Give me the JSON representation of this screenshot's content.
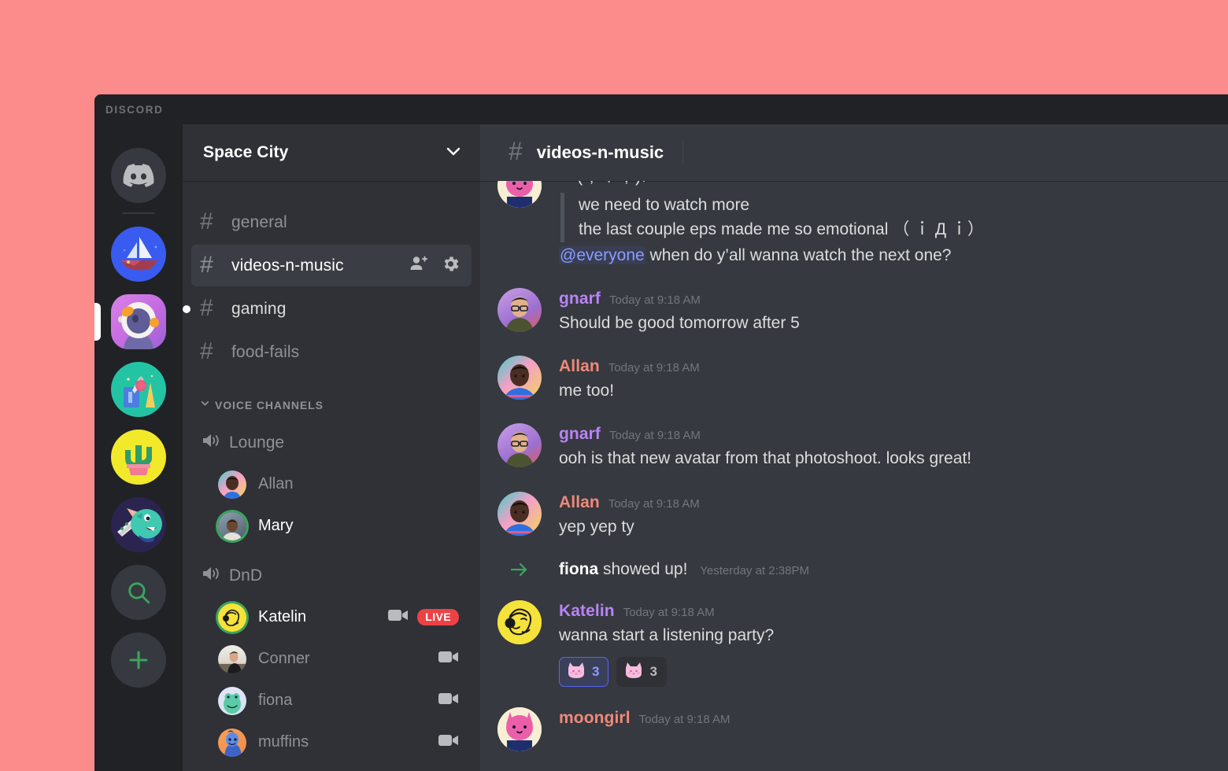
{
  "window": {
    "wordmark": "DISCORD"
  },
  "colors": {
    "page_background": "#FC8B8B",
    "titlebar": "#202225",
    "server_rail": "#202225",
    "channel_sidebar": "#2F3136",
    "chat_background": "#36393F",
    "accent_blurple": "#5865F2",
    "live_red": "#ED4245",
    "online_green": "#3BA55D",
    "mention_blue": "#8A9CFF"
  },
  "server_rail": {
    "home_icon": "discord-home-icon",
    "servers": [
      {
        "name": "sailboat-server",
        "icon": "sailboat-icon",
        "selected": false,
        "shape": "circle"
      },
      {
        "name": "space-city-server",
        "icon": "astronaut-icon",
        "selected": true,
        "shape": "squircle"
      },
      {
        "name": "art-supplies-server",
        "icon": "art-supplies-icon",
        "selected": false,
        "shape": "circle"
      },
      {
        "name": "cactus-server",
        "icon": "cactus-icon",
        "selected": false,
        "shape": "circle"
      },
      {
        "name": "monster-server",
        "icon": "monster-icon",
        "selected": false,
        "shape": "circle"
      }
    ],
    "explore_label": "search-icon",
    "add_label": "plus-icon"
  },
  "sidebar": {
    "server_name": "Space City",
    "dropdown_icon": "chevron-down-icon",
    "text_channels": [
      {
        "name": "general",
        "state": "read",
        "active": false
      },
      {
        "name": "videos-n-music",
        "state": "read",
        "active": true,
        "actions": [
          "add-member-icon",
          "gear-icon"
        ]
      },
      {
        "name": "gaming",
        "state": "unread",
        "active": false
      },
      {
        "name": "food-fails",
        "state": "read",
        "active": false
      }
    ],
    "voice_category": {
      "label": "VOICE CHANNELS",
      "collapse_icon": "chevron-down-icon"
    },
    "voice_channels": [
      {
        "name": "Lounge",
        "icon": "speaker-icon",
        "members": [
          {
            "name": "Allan",
            "speaking": false,
            "avatar": "allan-avatar",
            "video": false,
            "live": false
          },
          {
            "name": "Mary",
            "speaking": true,
            "avatar": "mary-avatar",
            "video": false,
            "live": false
          }
        ]
      },
      {
        "name": "DnD",
        "icon": "speaker-icon",
        "members": [
          {
            "name": "Katelin",
            "speaking": true,
            "avatar": "katelin-avatar",
            "video": true,
            "live": true,
            "live_label": "LIVE"
          },
          {
            "name": "Conner",
            "speaking": false,
            "avatar": "conner-avatar",
            "video": true,
            "live": false
          },
          {
            "name": "fiona",
            "speaking": false,
            "avatar": "fiona-avatar",
            "video": true,
            "live": false
          },
          {
            "name": "muffins",
            "speaking": false,
            "avatar": "muffins-avatar",
            "video": true,
            "live": false
          }
        ]
      }
    ]
  },
  "channel_header": {
    "hash_icon": "hash-icon",
    "title": "videos-n-music"
  },
  "messages": [
    {
      "type": "message",
      "partial_top": true,
      "author": "",
      "author_color": "",
      "timestamp": "",
      "avatar": "moongirl-avatar",
      "emoticon_line": "ヽ( ; ▽ ; )ﾉ",
      "quote_lines": [
        "we need to watch more",
        "the last couple eps made me so emotional （ ｉ Д ｉ）"
      ],
      "mention": "@everyone",
      "mention_rest": " when do y’all wanna watch the next one?"
    },
    {
      "type": "message",
      "author": "gnarf",
      "author_color": "#B984F5",
      "timestamp": "Today at 9:18 AM",
      "avatar": "gnarf-avatar",
      "text": "Should be good tomorrow after 5"
    },
    {
      "type": "message",
      "author": "Allan",
      "author_color": "#F0897A",
      "timestamp": "Today at 9:18 AM",
      "avatar": "allan-avatar",
      "text": "me too!"
    },
    {
      "type": "message",
      "author": "gnarf",
      "author_color": "#B984F5",
      "timestamp": "Today at 9:18 AM",
      "avatar": "gnarf-avatar",
      "text": "ooh is that new avatar from that photoshoot. looks great!"
    },
    {
      "type": "message",
      "author": "Allan",
      "author_color": "#F0897A",
      "timestamp": "Today at 9:18 AM",
      "avatar": "allan-avatar",
      "text": "yep yep ty"
    },
    {
      "type": "system",
      "icon": "arrow-right-icon",
      "actor": "fiona",
      "text": " showed up!",
      "timestamp": "Yesterday at 2:38PM"
    },
    {
      "type": "message",
      "author": "Katelin",
      "author_color": "#B984F5",
      "timestamp": "Today at 9:18 AM",
      "avatar": "katelin-avatar",
      "text": "wanna start a listening party?",
      "reactions": [
        {
          "emoji": "cat-emoji",
          "count": "3",
          "reacted": true
        },
        {
          "emoji": "cat-emoji",
          "count": "3",
          "reacted": false
        }
      ]
    },
    {
      "type": "message",
      "author": "moongirl",
      "author_color": "#F0897A",
      "timestamp": "Today at 9:18 AM",
      "avatar": "moongirl-avatar",
      "text": ""
    }
  ]
}
